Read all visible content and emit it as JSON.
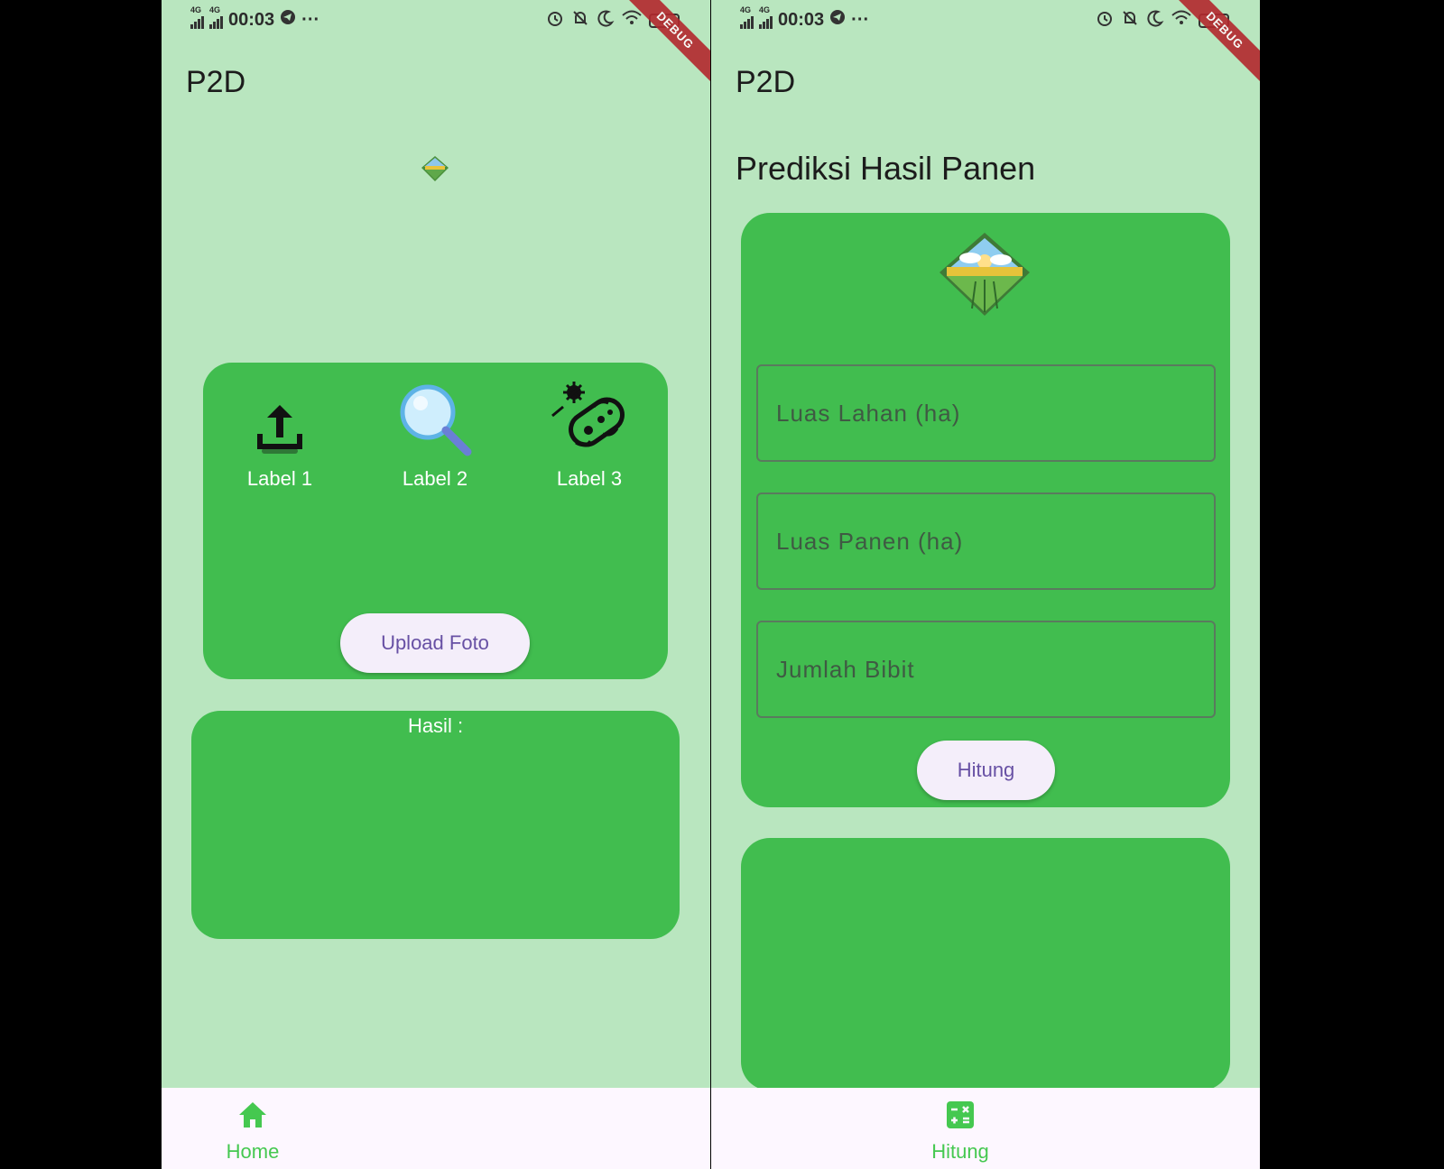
{
  "status_bar": {
    "network1": "4G",
    "network2": "4G",
    "time": "00:03",
    "more": "···",
    "battery": "40"
  },
  "debug_banner": "DEBUG",
  "left_screen": {
    "app_title": "P2D",
    "features": [
      {
        "label": "Label 1",
        "icon": "upload-icon"
      },
      {
        "label": "Label 2",
        "icon": "magnifier-icon"
      },
      {
        "label": "Label 3",
        "icon": "bacteria-icon"
      }
    ],
    "upload_button": "Upload Foto",
    "result_label": "Hasil :",
    "nav": {
      "label": "Home",
      "icon": "home-icon"
    }
  },
  "right_screen": {
    "app_title": "P2D",
    "section_title": "Prediksi Hasil Panen",
    "fields": [
      {
        "placeholder": "Luas Lahan (ha)",
        "value": ""
      },
      {
        "placeholder": "Luas Panen (ha)",
        "value": ""
      },
      {
        "placeholder": "Jumlah Bibit",
        "value": ""
      }
    ],
    "hitung_button": "Hitung",
    "nav": {
      "label": "Hitung",
      "icon": "calculator-icon"
    }
  },
  "colors": {
    "background": "#b9e6bf",
    "card": "#41bd4f",
    "nav_active": "#45c850",
    "button_text": "#6750a4",
    "debug": "#b3282d"
  }
}
